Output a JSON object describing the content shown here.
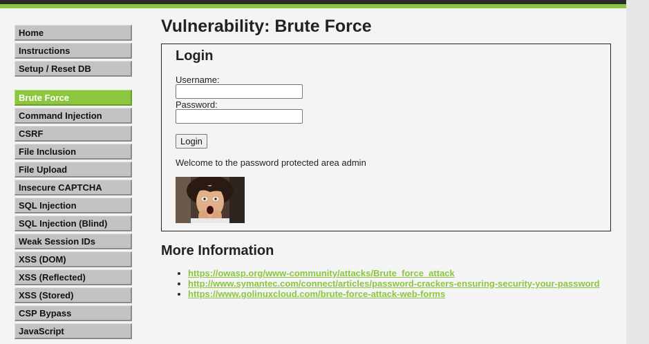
{
  "menu": {
    "groups": [
      {
        "items": [
          {
            "label": "Home"
          },
          {
            "label": "Instructions"
          },
          {
            "label": "Setup / Reset DB"
          }
        ]
      },
      {
        "items": [
          {
            "label": "Brute Force",
            "selected": true
          },
          {
            "label": "Command Injection"
          },
          {
            "label": "CSRF"
          },
          {
            "label": "File Inclusion"
          },
          {
            "label": "File Upload"
          },
          {
            "label": "Insecure CAPTCHA"
          },
          {
            "label": "SQL Injection"
          },
          {
            "label": "SQL Injection (Blind)"
          },
          {
            "label": "Weak Session IDs"
          },
          {
            "label": "XSS (DOM)"
          },
          {
            "label": "XSS (Reflected)"
          },
          {
            "label": "XSS (Stored)"
          },
          {
            "label": "CSP Bypass"
          },
          {
            "label": "JavaScript"
          }
        ]
      }
    ]
  },
  "main": {
    "title": "Vulnerability: Brute Force",
    "login": {
      "heading": "Login",
      "username_label": "Username:",
      "username_value": "",
      "password_label": "Password:",
      "password_value": "",
      "button_label": "Login",
      "welcome": "Welcome to the password protected area admin"
    },
    "more_info": {
      "heading": "More Information",
      "links": [
        "https://owasp.org/www-community/attacks/Brute_force_attack",
        "http://www.symantec.com/connect/articles/password-crackers-ensuring-security-your-password",
        "https://www.golinuxcloud.com/brute-force-attack-web-forms"
      ]
    }
  },
  "colors": {
    "accent_green": "#8cc63f",
    "header_dark": "#2b2b2b",
    "menu_bg": "#c3c3c3",
    "page_bg": "#f4f4f4"
  }
}
